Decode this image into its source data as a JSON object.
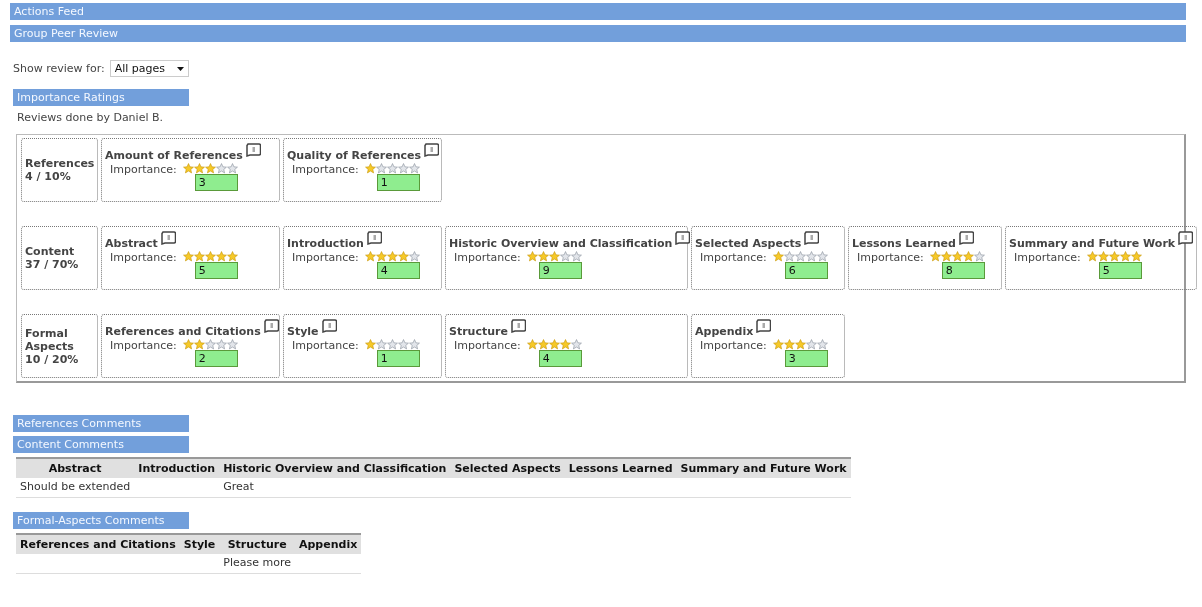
{
  "sections": [
    {
      "title": "Actions Feed"
    },
    {
      "title": "Group Peer Review"
    }
  ],
  "filter": {
    "label": "Show review for:",
    "value": "All pages"
  },
  "ratings": {
    "title": "Importance Ratings",
    "reviewer": "Reviews done by Daniel B.",
    "groups": [
      {
        "name": "References",
        "score": "4 / 10%",
        "items": [
          {
            "title": "Amount of References",
            "label": "Importance:",
            "stars": 3,
            "value": "3"
          },
          {
            "title": "Quality of References",
            "label": "Importance:",
            "stars": 1,
            "value": "1"
          }
        ]
      },
      {
        "name": "Content",
        "score": "37 / 70%",
        "items": [
          {
            "title": "Abstract",
            "label": "Importance:",
            "stars": 5,
            "value": "5"
          },
          {
            "title": "Introduction",
            "label": "Importance:",
            "stars": 4,
            "value": "4"
          },
          {
            "title": "Historic Overview and Classification",
            "label": "Importance:",
            "stars": 3,
            "value": "9"
          },
          {
            "title": "Selected Aspects",
            "label": "Importance:",
            "stars": 1,
            "value": "6"
          },
          {
            "title": "Lessons Learned",
            "label": "Importance:",
            "stars": 4,
            "value": "8"
          },
          {
            "title": "Summary and Future Work",
            "label": "Importance:",
            "stars": 5,
            "value": "5"
          }
        ]
      },
      {
        "name": "Formal Aspects",
        "score": "10 / 20%",
        "items": [
          {
            "title": "References and Citations",
            "label": "Importance:",
            "stars": 2,
            "value": "2"
          },
          {
            "title": "Style",
            "label": "Importance:",
            "stars": 1,
            "value": "1"
          },
          {
            "title": "Structure",
            "label": "Importance:",
            "stars": 4,
            "value": "4"
          },
          {
            "title": "Appendix",
            "label": "Importance:",
            "stars": 3,
            "value": "3"
          }
        ]
      }
    ]
  },
  "comments": [
    {
      "title": "References Comments"
    },
    {
      "title": "Content Comments",
      "columns": [
        "Abstract",
        "Introduction",
        "Historic Overview and Classification",
        "Selected Aspects",
        "Lessons Learned",
        "Summary and Future Work"
      ],
      "rows": [
        [
          "Should be extended",
          "",
          "Great",
          "",
          "",
          ""
        ]
      ]
    },
    {
      "title": "Formal-Aspects Comments",
      "columns": [
        "References and Citations",
        "Style",
        "Structure",
        "Appendix"
      ],
      "rows": [
        [
          "",
          "",
          "Please more",
          ""
        ]
      ]
    }
  ]
}
